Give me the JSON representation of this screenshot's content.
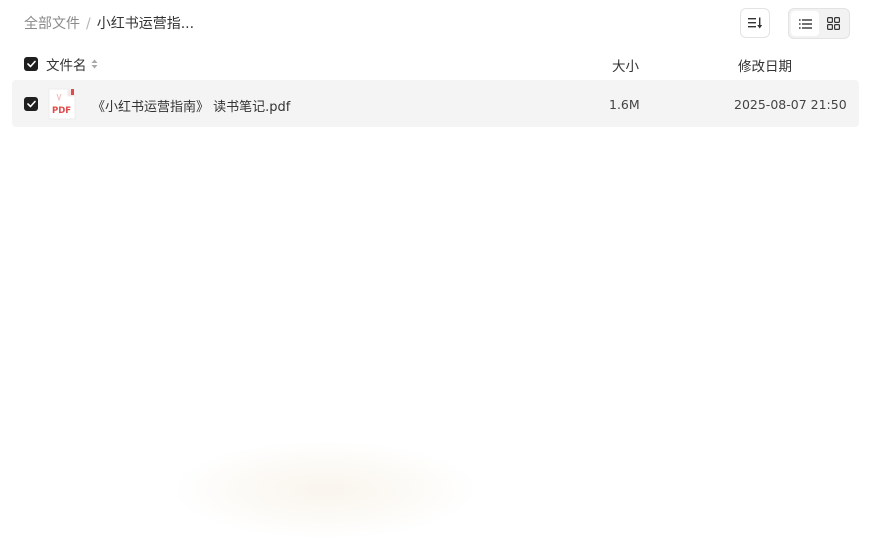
{
  "breadcrumb": {
    "root": "全部文件",
    "separator": "/",
    "current": "小红书运营指..."
  },
  "toolbar": {
    "sort_icon": "sort-list-icon",
    "view_list_icon": "list-view-icon",
    "view_grid_icon": "grid-view-icon",
    "active_view": "list"
  },
  "table": {
    "columns": {
      "name": "文件名",
      "size": "大小",
      "date": "修改日期"
    },
    "select_all_checked": true,
    "rows": [
      {
        "checked": true,
        "icon": "pdf-file-icon",
        "icon_label": "PDF",
        "name": "《小红书运营指南》 读书笔记.pdf",
        "size": "1.6M",
        "date": "2025-08-07 21:50"
      }
    ]
  },
  "colors": {
    "checkbox": "#1f1f1f",
    "row_background": "#f4f4f4",
    "pdf_red": "#e04a4a",
    "muted_text": "#8a8a8a"
  }
}
